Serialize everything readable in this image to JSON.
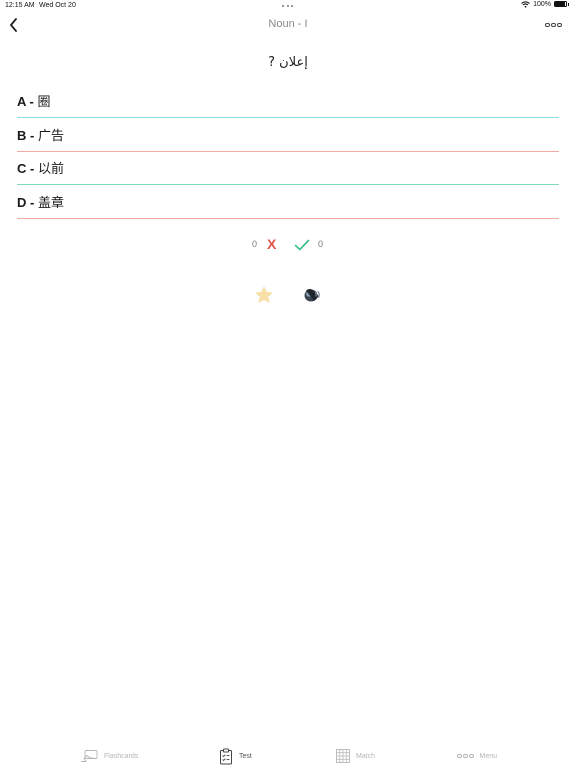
{
  "status_bar": {
    "time": "12:15 AM",
    "date": "Wed Oct 20",
    "battery": "100%",
    "icons": [
      "wifi-icon",
      "battery-icon"
    ]
  },
  "nav": {
    "title": "Noun - I",
    "back_icon": "chevron-left-icon",
    "more_icon": "more-dots-icon"
  },
  "question": "إعلان ?",
  "answers": [
    {
      "letter": "A",
      "text": "圈",
      "underline_color": "#8bdde2"
    },
    {
      "letter": "B",
      "text": "广告",
      "underline_color": "#f2a9a3"
    },
    {
      "letter": "C",
      "text": "以前",
      "underline_color": "#7fdcb5"
    },
    {
      "letter": "D",
      "text": "盖章",
      "underline_color": "#f2a9a3"
    }
  ],
  "score": {
    "wrong_count": "0",
    "wrong_mark": "X",
    "right_count": "0",
    "wrong_color": "#e0544a",
    "right_color": "#3fbf8a"
  },
  "actions": {
    "favorite_icon": "star-icon",
    "audio_icon": "speaker-icon",
    "star_color": "#f7e0a8"
  },
  "tabs": [
    {
      "label": "Flashcards",
      "icon": "flashcards-icon",
      "active": false
    },
    {
      "label": "Test",
      "icon": "clipboard-icon",
      "active": true
    },
    {
      "label": "Match",
      "icon": "grid-icon",
      "active": false
    },
    {
      "label": "Menu",
      "icon": "more-dots-icon",
      "active": false
    }
  ]
}
